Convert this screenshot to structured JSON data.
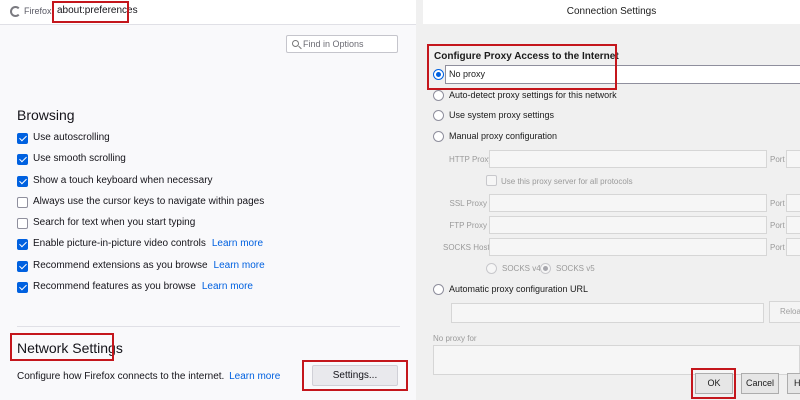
{
  "preferences": {
    "browser_name": "Firefox",
    "url": "about:preferences",
    "find_placeholder": "Find in Options",
    "browsing": {
      "heading": "Browsing",
      "items": [
        {
          "label": "Use autoscrolling",
          "checked": true,
          "learn_more": ""
        },
        {
          "label": "Use smooth scrolling",
          "checked": true,
          "learn_more": ""
        },
        {
          "label": "Show a touch keyboard when necessary",
          "checked": true,
          "learn_more": ""
        },
        {
          "label": "Always use the cursor keys to navigate within pages",
          "checked": false,
          "learn_more": ""
        },
        {
          "label": "Search for text when you start typing",
          "checked": false,
          "learn_more": ""
        },
        {
          "label": "Enable picture-in-picture video controls",
          "checked": true,
          "learn_more": "Learn more"
        },
        {
          "label": "Recommend extensions as you browse",
          "checked": true,
          "learn_more": "Learn more"
        },
        {
          "label": "Recommend features as you browse",
          "checked": true,
          "learn_more": "Learn more"
        }
      ]
    },
    "network": {
      "heading": "Network Settings",
      "description": "Configure how Firefox connects to the internet.",
      "learn_more": "Learn more",
      "settings_button": "Settings..."
    }
  },
  "dialog": {
    "title": "Connection Settings",
    "section_heading": "Configure Proxy Access to the Internet",
    "options": [
      {
        "label": "No proxy",
        "selected": true
      },
      {
        "label": "Auto-detect proxy settings for this network",
        "selected": false
      },
      {
        "label": "Use system proxy settings",
        "selected": false
      },
      {
        "label": "Manual proxy configuration",
        "selected": false
      }
    ],
    "manual": {
      "http_proxy": "HTTP Proxy",
      "port": "Port",
      "use_for_all": "Use this proxy server for all protocols",
      "ssl_proxy": "SSL Proxy",
      "ftp_proxy": "FTP Proxy",
      "socks_host": "SOCKS Host",
      "socks_v4": "SOCKS v4",
      "socks_v5": "SOCKS v5"
    },
    "auto_config_label": "Automatic proxy configuration URL",
    "reload_button": "Reload",
    "no_proxy_for": "No proxy for",
    "ok_button": "OK",
    "cancel_button": "Cancel",
    "help_button": "H"
  },
  "colors": {
    "highlight": "#c4161c",
    "accent": "#0061e0",
    "link": "#0061e0"
  }
}
